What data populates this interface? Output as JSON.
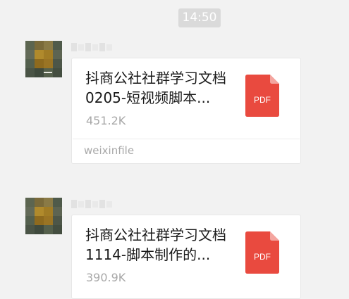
{
  "chat": {
    "timestamp": "14:50",
    "messages": [
      {
        "file_name": "抖商公社社群学习文档0205-短视频脚本...",
        "file_size": "451.2K",
        "source": "weixinfile",
        "icon": "pdf-icon",
        "icon_label": "PDF"
      },
      {
        "file_name": "抖商公社社群学习文档1114-脚本制作的...",
        "file_size": "390.9K",
        "icon": "pdf-icon",
        "icon_label": "PDF"
      }
    ]
  },
  "colors": {
    "background": "#f2f2f2",
    "pdf_red": "#e94a3f",
    "timestamp_bg": "#dadada"
  }
}
